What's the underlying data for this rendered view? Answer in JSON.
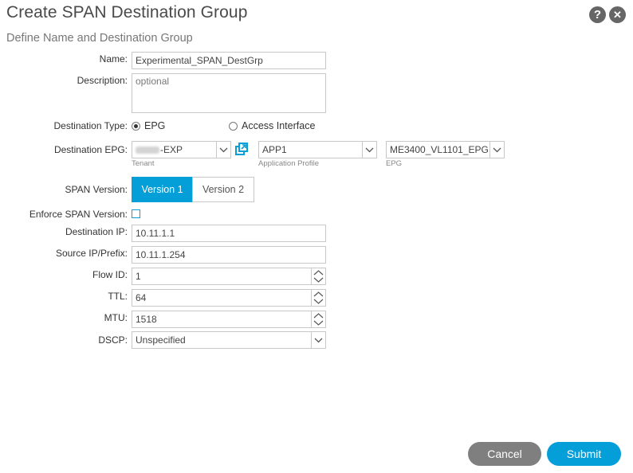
{
  "header": {
    "title": "Create SPAN Destination Group",
    "subtitle": "Define Name and Destination Group",
    "help_glyph": "?",
    "close_glyph": "✕"
  },
  "form": {
    "name": {
      "label": "Name:",
      "value": "Experimental_SPAN_DestGrp"
    },
    "description": {
      "label": "Description:",
      "placeholder": "optional"
    },
    "destination_type": {
      "label": "Destination Type:",
      "options": [
        "EPG",
        "Access Interface"
      ],
      "selected": "EPG"
    },
    "destination_epg": {
      "label": "Destination EPG:",
      "tenant": {
        "value_suffix": "-EXP",
        "sublabel": "Tenant"
      },
      "app_profile": {
        "value": "APP1",
        "sublabel": "Application Profile"
      },
      "epg": {
        "value": "ME3400_VL1101_EPG",
        "sublabel": "EPG"
      }
    },
    "span_version": {
      "label": "SPAN Version:",
      "options": [
        "Version 1",
        "Version 2"
      ],
      "selected": "Version 1"
    },
    "enforce_span_version": {
      "label": "Enforce SPAN Version:",
      "checked": false
    },
    "destination_ip": {
      "label": "Destination IP:",
      "value": "10.11.1.1"
    },
    "source_ip": {
      "label": "Source IP/Prefix:",
      "value": "10.11.1.254"
    },
    "flow_id": {
      "label": "Flow ID:",
      "value": "1"
    },
    "ttl": {
      "label": "TTL:",
      "value": "64"
    },
    "mtu": {
      "label": "MTU:",
      "value": "1518"
    },
    "dscp": {
      "label": "DSCP:",
      "value": "Unspecified"
    }
  },
  "footer": {
    "cancel_label": "Cancel",
    "submit_label": "Submit"
  },
  "colors": {
    "accent": "#049fd9",
    "cancel_bg": "#7f7f7f",
    "border": "#c8c8c8"
  }
}
